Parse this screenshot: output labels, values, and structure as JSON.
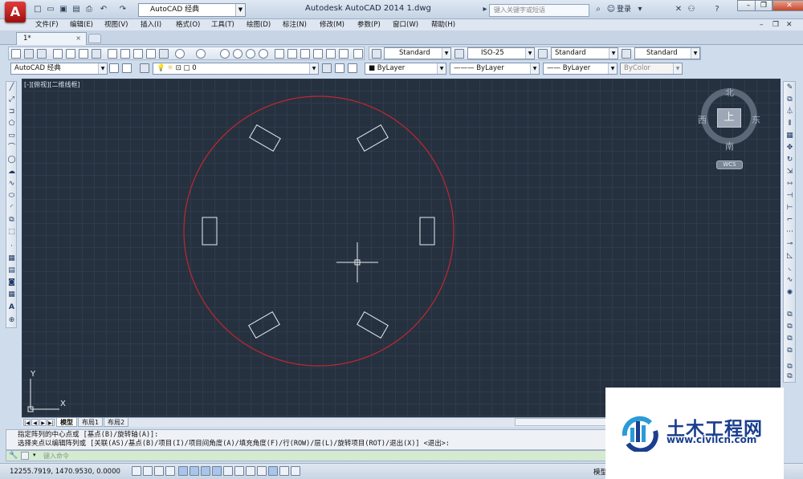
{
  "app": {
    "logo_letter": "A",
    "workspace": "AutoCAD 经典",
    "window_title": "Autodesk AutoCAD 2014    1.dwg",
    "search_placeholder": "键入关键字或短语",
    "login": "登录",
    "help": "?"
  },
  "menu": [
    "文件(F)",
    "编辑(E)",
    "视图(V)",
    "插入(I)",
    "格式(O)",
    "工具(T)",
    "绘图(D)",
    "标注(N)",
    "修改(M)",
    "参数(P)",
    "窗口(W)",
    "帮助(H)"
  ],
  "document_tab": {
    "label": "1*",
    "close": "×"
  },
  "styles_toolbar": {
    "text_style": "Standard",
    "dim_style": "ISO-25",
    "table_style": "Standard",
    "multileader_style": "Standard"
  },
  "layers_toolbar": {
    "workspace": "AutoCAD 经典",
    "layer": "0",
    "color": "ByLayer",
    "linetype": "ByLayer",
    "lineweight": "ByLayer",
    "plotstyle": "ByColor"
  },
  "viewport": {
    "label": "[-][俯视][二维线框]",
    "viewcube_face": "上",
    "north": "北",
    "south": "南",
    "east": "东",
    "west": "西",
    "wcs": "WCS",
    "ucs_x": "X",
    "ucs_y": "Y",
    "colors": {
      "background": "#263140",
      "circle": "#c0282d",
      "rectangles": "#e6ecf2"
    }
  },
  "layout_tabs": [
    "模型",
    "布局1",
    "布局2"
  ],
  "command": {
    "history": [
      "指定阵列的中心点或 [基点(B)/旋转轴(A)]:",
      "选择夹点以编辑阵列或 [关联(AS)/基点(B)/项目(I)/项目间角度(A)/填充角度(F)/行(ROW)/层(L)/旋转项目(ROT)/退出(X)] <退出>:"
    ],
    "placeholder": "键入命令"
  },
  "status": {
    "coordinates": "12255.7919, 1470.9530, 0.0000",
    "model": "模型"
  },
  "watermark": {
    "title": "土木工程网",
    "url": "www.civilcn.com"
  }
}
